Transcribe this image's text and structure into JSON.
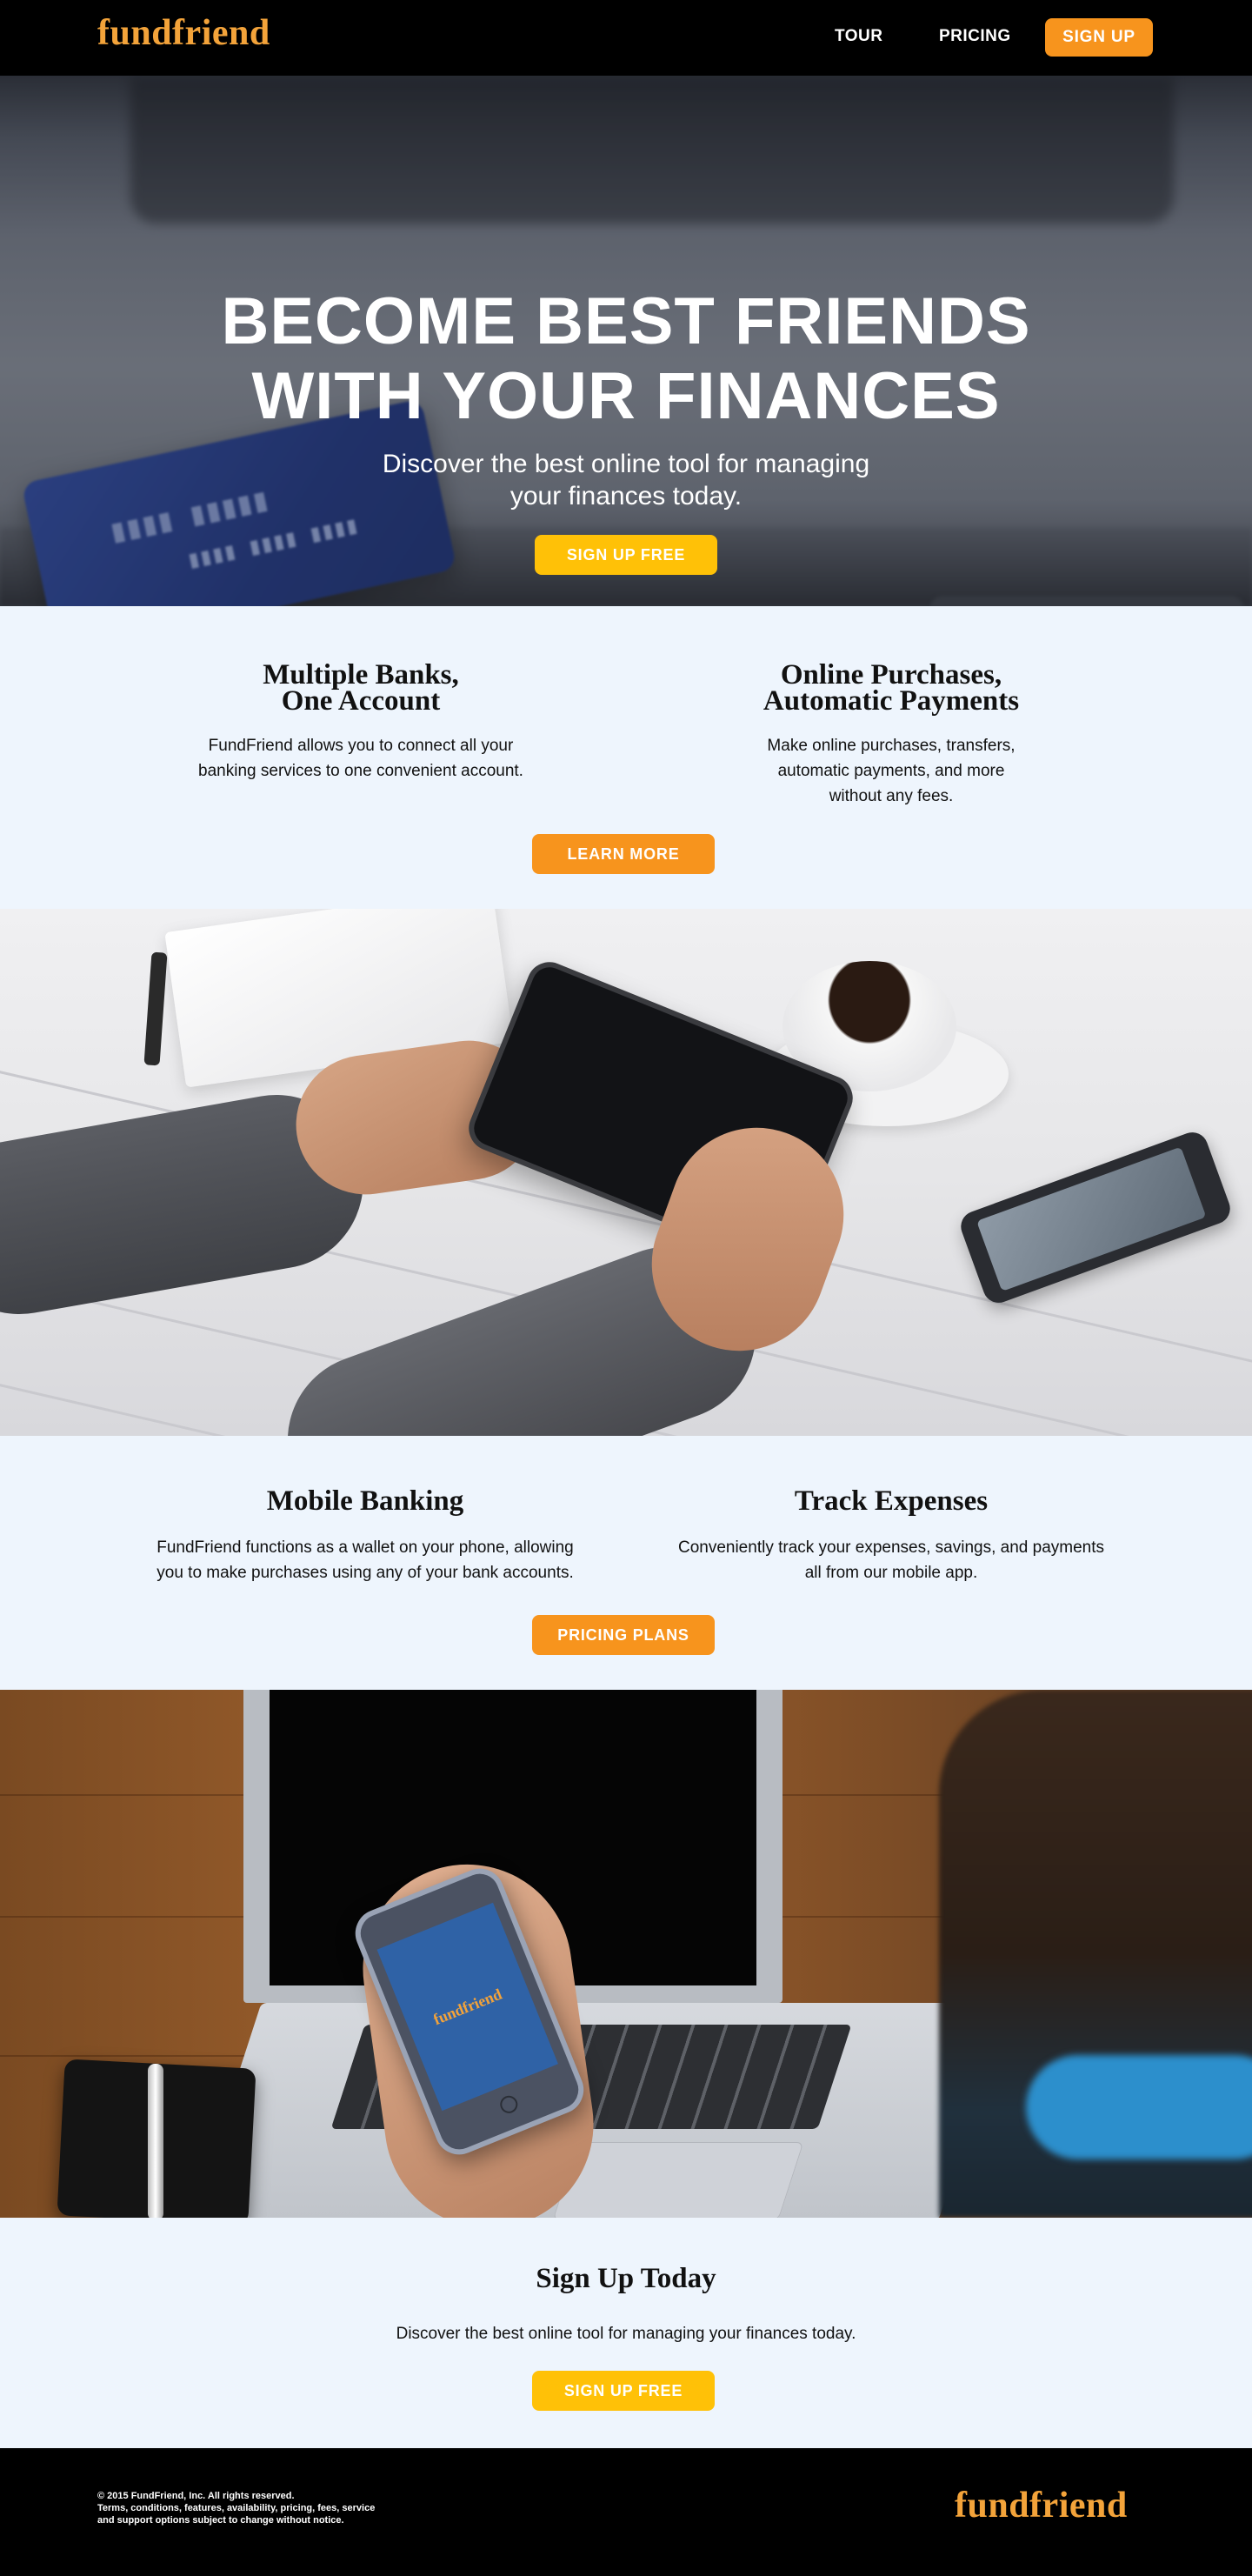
{
  "brand": {
    "logo": "fundfriend",
    "logo_color": "#f3a33a"
  },
  "nav": {
    "links": [
      {
        "label": "TOUR"
      },
      {
        "label": "PRICING"
      }
    ],
    "signup_label": "SIGN UP"
  },
  "hero": {
    "title_line1": "BECOME BEST FRIENDS",
    "title_line2": "WITH YOUR FINANCES",
    "subtitle_line1": "Discover the best online tool for managing",
    "subtitle_line2": "your finances today.",
    "cta": "SIGN UP FREE"
  },
  "features_1": {
    "items": [
      {
        "title_line1": "Multiple Banks,",
        "title_line2": "One Account",
        "text_line1": "FundFriend allows you to connect all your",
        "text_line2": "banking services to one convenient account."
      },
      {
        "title_line1": "Online Purchases,",
        "title_line2": "Automatic Payments",
        "text_line1": "Make online purchases, transfers,",
        "text_line2": "automatic payments, and more",
        "text_line3": "without any fees."
      }
    ],
    "cta": "LEARN MORE"
  },
  "features_2": {
    "items": [
      {
        "title": "Mobile Banking",
        "text_line1": "FundFriend functions as a wallet on your phone, allowing",
        "text_line2": "you to make purchases using any of your bank accounts."
      },
      {
        "title": "Track Expenses",
        "text_line1": "Conveniently track your expenses, savings, and payments",
        "text_line2": "all from our mobile app."
      }
    ],
    "cta": "PRICING PLANS"
  },
  "signup": {
    "title": "Sign Up Today",
    "text": "Discover the best online tool for managing your finances today.",
    "cta": "SIGN UP FREE"
  },
  "footer": {
    "legal_line1": "© 2015 FundFriend, Inc. All rights reserved.",
    "legal_line2": "Terms, conditions, features, availability, pricing, fees, service",
    "legal_line3": "and support options subject to change without notice.",
    "logo": "fundfriend"
  },
  "colors": {
    "accent_orange": "#f7941d",
    "accent_yellow": "#ffc107",
    "section_bg": "#eef5fd",
    "nav_bg": "#000000"
  }
}
